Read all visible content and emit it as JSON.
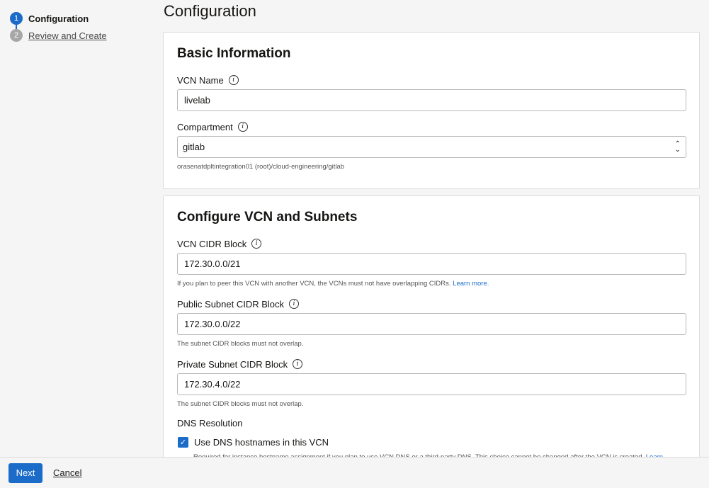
{
  "steps": [
    {
      "number": "1",
      "label": "Configuration"
    },
    {
      "number": "2",
      "label": "Review and Create"
    }
  ],
  "page_title": "Configuration",
  "basic_info": {
    "title": "Basic Information",
    "vcn_name": {
      "label": "VCN Name",
      "value": "livelab"
    },
    "compartment": {
      "label": "Compartment",
      "value": "gitlab",
      "path": "orasenatdpltintegration01 (root)/cloud-engineering/gitlab"
    }
  },
  "configure": {
    "title": "Configure VCN and Subnets",
    "vcn_cidr": {
      "label": "VCN CIDR Block",
      "value": "172.30.0.0/21",
      "help": "If you plan to peer this VCN with another VCN, the VCNs must not have overlapping CIDRs.",
      "help_link": "Learn more."
    },
    "public_subnet": {
      "label": "Public Subnet CIDR Block",
      "value": "172.30.0.0/22",
      "help": "The subnet CIDR blocks must not overlap."
    },
    "private_subnet": {
      "label": "Private Subnet CIDR Block",
      "value": "172.30.4.0/22",
      "help": "The subnet CIDR blocks must not overlap."
    },
    "dns": {
      "heading": "DNS Resolution",
      "checkbox_label": "Use DNS hostnames in this VCN",
      "checked": true,
      "help": "Required for instance hostname assignment if you plan to use VCN DNS or a third-party DNS. This choice cannot be changed after the VCN is created.",
      "help_link": "Learn"
    }
  },
  "footer": {
    "next_label": "Next",
    "cancel_label": "Cancel"
  },
  "colors": {
    "accent": "#1b6bc8",
    "inactive_step": "#a7a7a7"
  },
  "icons": {
    "info": "info-icon",
    "select": "chevron-up-down-icon",
    "check": "check-icon"
  }
}
